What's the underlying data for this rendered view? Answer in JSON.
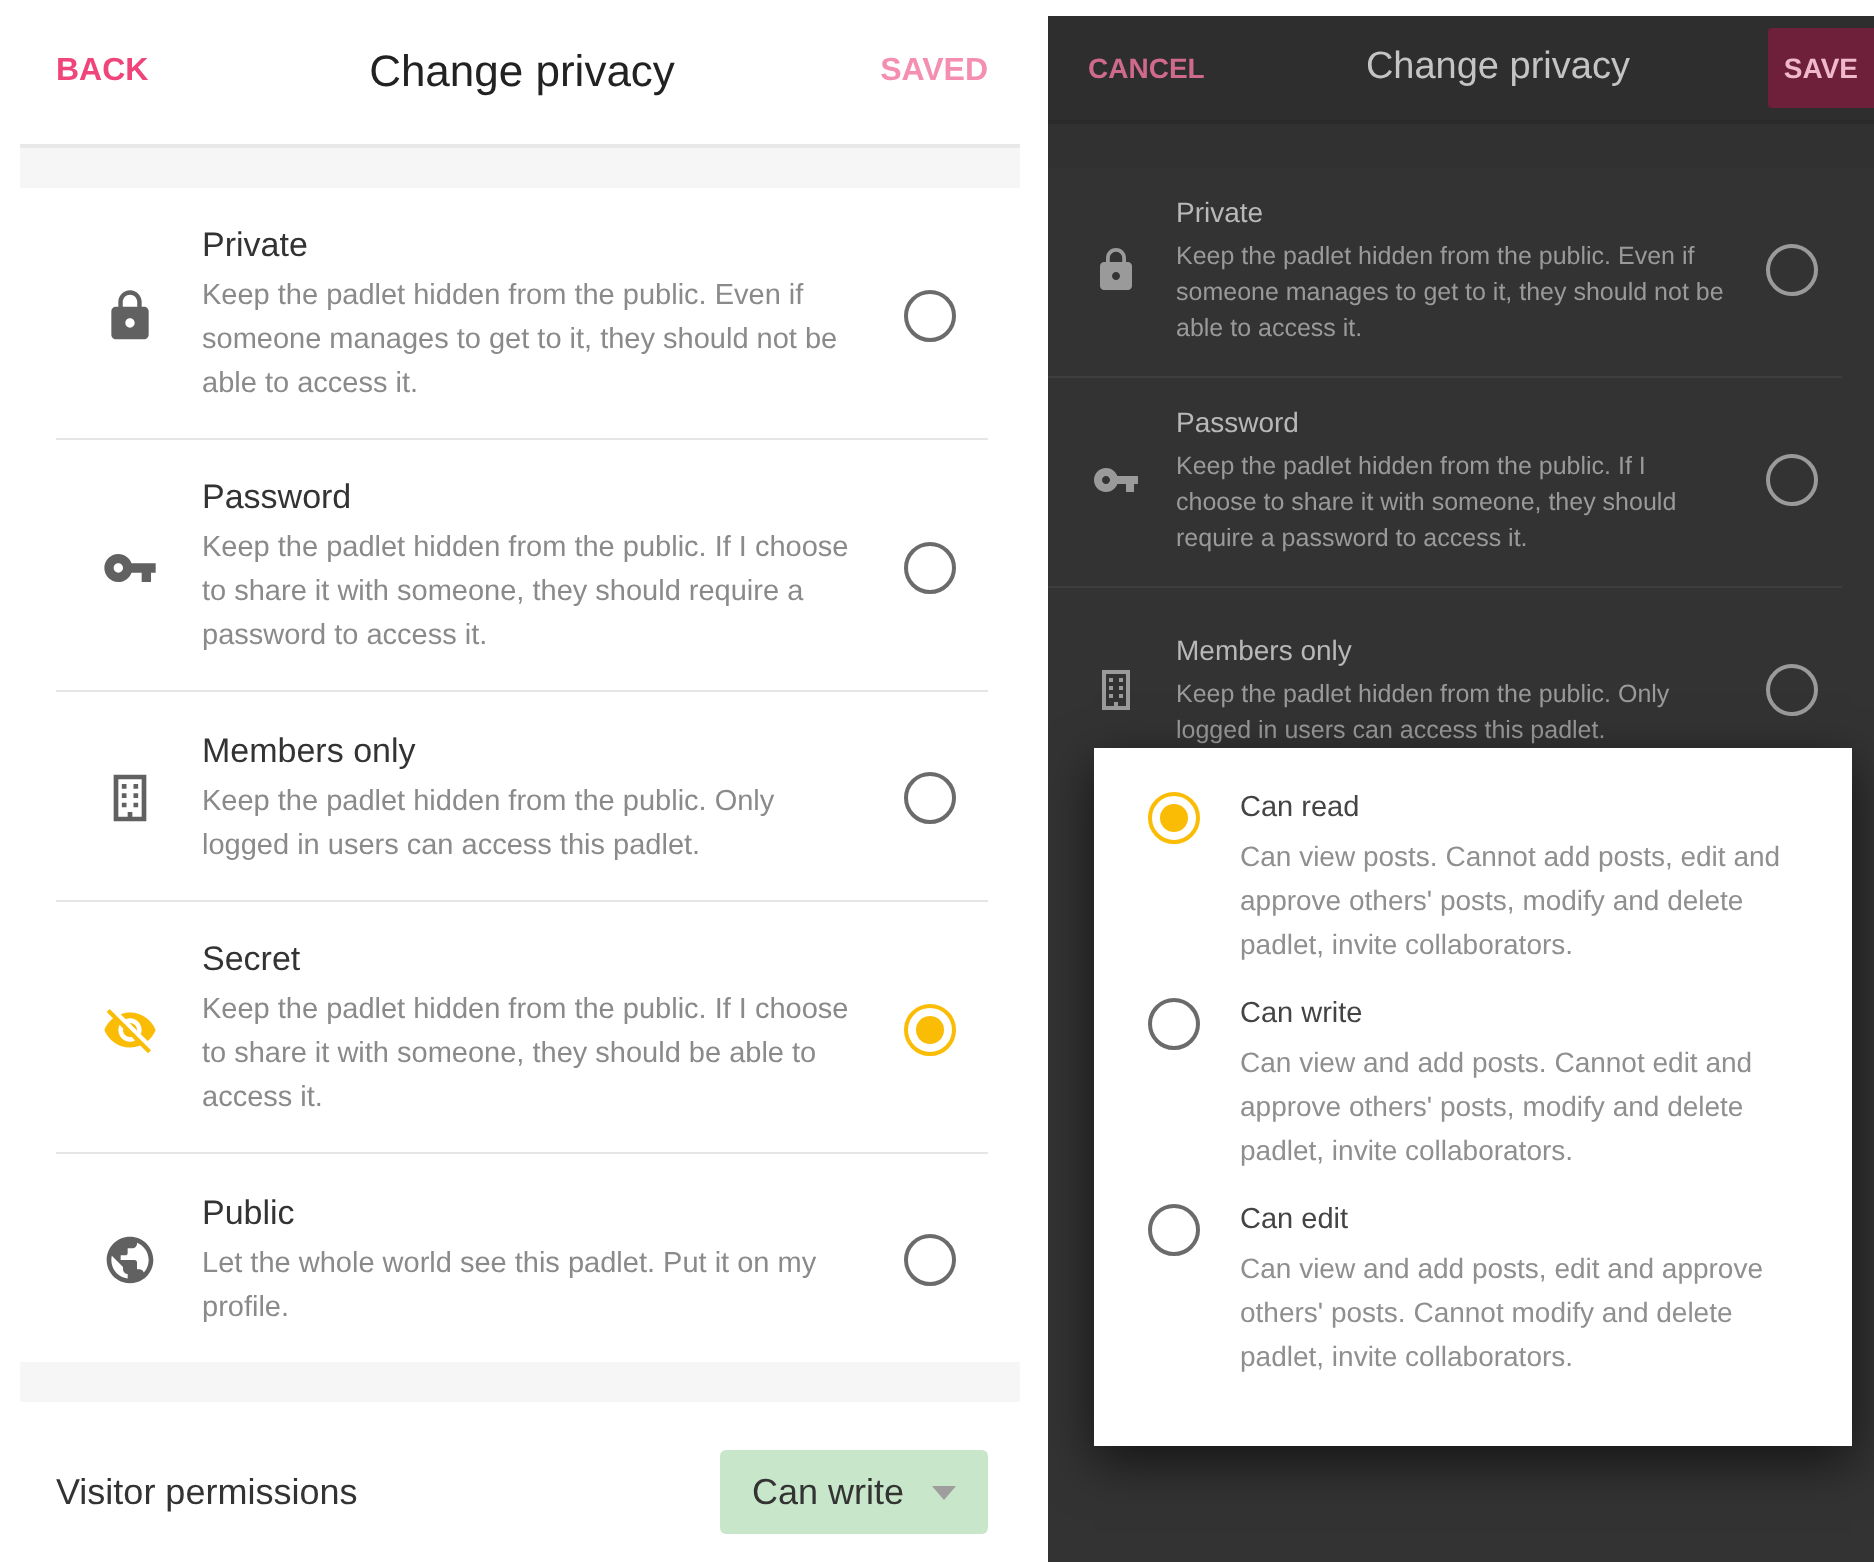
{
  "left_screen": {
    "header": {
      "left_action": "BACK",
      "title": "Change privacy",
      "right_action": {
        "label": "SAVED",
        "disabled": true
      }
    },
    "options": [
      {
        "kind": "lock",
        "title": "Private",
        "description": "Keep the padlet hidden from the public. Even if someone manages to get to it, they should not be able to access it.",
        "selected": false
      },
      {
        "kind": "key",
        "title": "Password",
        "description": "Keep the padlet hidden from the public. If I choose to share it with someone, they should require a password to access it.",
        "selected": false
      },
      {
        "kind": "building",
        "title": "Members only",
        "description": "Keep the padlet hidden from the public. Only logged in users can access this padlet.",
        "selected": false
      },
      {
        "kind": "eye-off",
        "title": "Secret",
        "description": "Keep the padlet hidden from the public. If I choose to share it with someone, they should be able to access it.",
        "selected": true
      },
      {
        "kind": "globe",
        "title": "Public",
        "description": "Let the whole world see this padlet. Put it on my profile.",
        "selected": false
      }
    ],
    "visitor_permissions": {
      "label": "Visitor permissions",
      "value": "Can write"
    }
  },
  "right_screen": {
    "dimmed": true,
    "header": {
      "left_action": "CANCEL",
      "title": "Change privacy",
      "right_action": {
        "label": "SAVE",
        "disabled": false
      }
    },
    "options": [
      {
        "kind": "lock",
        "title": "Private",
        "description": "Keep the padlet hidden from the public. Even if someone manages to get to it, they should not be able to access it.",
        "selected": false
      },
      {
        "kind": "key",
        "title": "Password",
        "description": "Keep the padlet hidden from the public. If I choose to share it with someone, they should require a password to access it.",
        "selected": false
      },
      {
        "kind": "building",
        "title": "Members only",
        "description": "Keep the padlet hidden from the public. Only logged in users can access this padlet.",
        "selected": false
      }
    ],
    "dialog": {
      "options": [
        {
          "title": "Can read",
          "description": "Can view posts. Cannot add posts, edit and approve others' posts, modify and delete padlet, invite collaborators.",
          "selected": true
        },
        {
          "title": "Can write",
          "description": "Can view and add posts. Cannot edit and approve others' posts, modify and delete padlet, invite collaborators.",
          "selected": false
        },
        {
          "title": "Can edit",
          "description": "Can view and add posts, edit and approve others' posts. Cannot modify and delete padlet, invite collaborators.",
          "selected": false
        }
      ]
    }
  }
}
